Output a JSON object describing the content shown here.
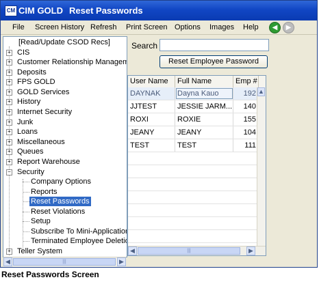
{
  "window": {
    "app_name": "CIM GOLD",
    "title": "Reset Passwords",
    "icon_text": "CM"
  },
  "menu": {
    "items": [
      "File",
      "Screen History",
      "Refresh",
      "Print Screen",
      "Options",
      "Images",
      "Help"
    ],
    "back_icon": "back-arrow-icon",
    "forward_icon": "forward-arrow-icon"
  },
  "tree": {
    "top_item": "[Read/Update CSOD Recs]",
    "items": [
      "CIS",
      "Customer Relationship Management",
      "Deposits",
      "FPS GOLD",
      "GOLD Services",
      "History",
      "Internet Security",
      "Junk",
      "Loans",
      "Miscellaneous",
      "Queues",
      "Report Warehouse",
      "Security"
    ],
    "security_children": [
      "Company Options",
      "Reports",
      "Reset Passwords",
      "Reset Violations",
      "Setup",
      "Subscribe To Mini-Applications",
      "Terminated Employee Deletion"
    ],
    "selected": "Reset Passwords",
    "bottom_item": "Teller System"
  },
  "search": {
    "label": "Search",
    "value": "",
    "button_label": "Reset Employee Password"
  },
  "grid": {
    "columns": [
      "User Name",
      "Full Name",
      "Emp #"
    ],
    "rows": [
      {
        "user": "DAYNAK",
        "full": "Dayna Kauo",
        "emp": "192"
      },
      {
        "user": "JJTEST",
        "full": "JESSIE JARM...",
        "emp": "140"
      },
      {
        "user": "ROXI",
        "full": "ROXIE",
        "emp": "155"
      },
      {
        "user": "JEANY",
        "full": "JEANY",
        "emp": "104"
      },
      {
        "user": "TEST",
        "full": "TEST",
        "emp": "111"
      }
    ]
  },
  "caption": "Reset Passwords Screen",
  "colors": {
    "titlebar": "#1146c4",
    "selection": "#316ac5",
    "panel": "#ece9d8"
  }
}
